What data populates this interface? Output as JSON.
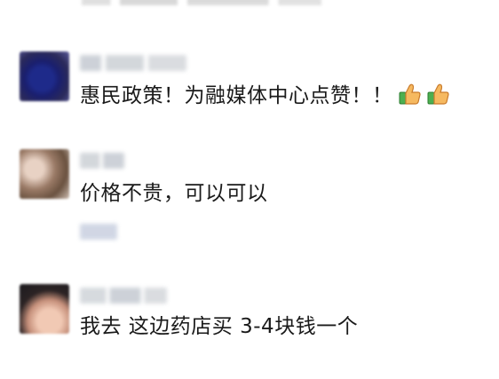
{
  "comments": [
    {
      "text": "惠民政策！为融媒体中心点赞！！",
      "emoji": [
        "thumbs-up",
        "thumbs-up"
      ]
    },
    {
      "text": "价格不贵，可以可以"
    },
    {
      "text": "我去 这边药店买 3-4块钱一个"
    }
  ],
  "colors": {
    "background": "#ffffff",
    "text": "#1a1a1a",
    "blur_gray": "#d4d4d4"
  }
}
